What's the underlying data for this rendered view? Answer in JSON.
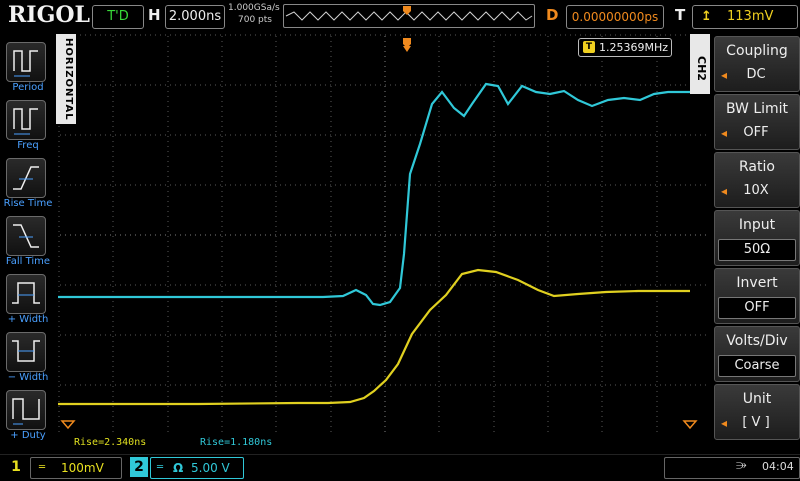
{
  "header": {
    "brand": "RIGOL",
    "trigger_status": "T'D",
    "horizontal_label": "H",
    "timebase": "2.000ns",
    "sample_rate": "1.000GSa/s",
    "memory_depth": "700 pts",
    "delay_label": "D",
    "delay": "0.00000000ps",
    "trigger_label": "T",
    "trigger_level": "113mV"
  },
  "left_menu": {
    "tab_label": "HORIZONTAL",
    "items": [
      {
        "label": "Period"
      },
      {
        "label": "Freq"
      },
      {
        "label": "Rise Time"
      },
      {
        "label": "Fall Time"
      },
      {
        "label": "+ Width"
      },
      {
        "label": "− Width"
      },
      {
        "label": "+ Duty"
      }
    ]
  },
  "right_menu": {
    "tab_label": "CH2",
    "items": [
      {
        "title": "Coupling",
        "value": "DC"
      },
      {
        "title": "BW Limit",
        "value": "OFF"
      },
      {
        "title": "Ratio",
        "value": "10X"
      },
      {
        "title": "Input",
        "value": "50Ω"
      },
      {
        "title": "Invert",
        "value": "OFF"
      },
      {
        "title": "Volts/Div",
        "value": "Coarse"
      },
      {
        "title": "Unit",
        "value": "[ V ]"
      }
    ]
  },
  "display": {
    "frequency_counter": "1.25369MHz",
    "measurements": [
      {
        "text": "Rise=2.340ns",
        "color": "#e0e020"
      },
      {
        "text": "Rise=1.180ns",
        "color": "#30c8d8"
      }
    ]
  },
  "footer": {
    "ch1": {
      "number": "1",
      "coupling": "═",
      "scale": "100mV",
      "color": "#e8e020"
    },
    "ch2": {
      "number": "2",
      "coupling": "═",
      "impedance": "Ω",
      "scale": "5.00 V",
      "color": "#30c8d8"
    },
    "time": "04:04"
  },
  "colors": {
    "ch1": "#e0d020",
    "ch2": "#30c8d8",
    "accent": "#f08a1e",
    "menu_label": "#4aa0ff"
  }
}
